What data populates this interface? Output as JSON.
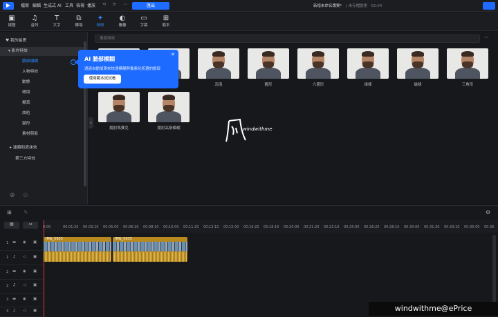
{
  "menu": [
    "檔案",
    "編輯",
    "生成式 AI",
    "工具",
    "檢視",
    "播放"
  ],
  "export_label": "匯出",
  "project_title": "新增未命名專案*",
  "project_meta": "| 未存檔變更 · 02:04",
  "toolbar": [
    {
      "icon": "media-icon",
      "label": "媒體"
    },
    {
      "icon": "audio-icon",
      "label": "音訊"
    },
    {
      "icon": "text-icon",
      "label": "文字"
    },
    {
      "icon": "transition-icon",
      "label": "轉場"
    },
    {
      "icon": "effect-icon",
      "label": "特效"
    },
    {
      "icon": "overlay-icon",
      "label": "覆疊"
    },
    {
      "icon": "subtitle-icon",
      "label": "字幕"
    },
    {
      "icon": "template-icon",
      "label": "範本"
    }
  ],
  "sidebar": {
    "favorites": "我的最愛",
    "video_effects": "影片特效",
    "items": [
      "臉部模糊",
      "人物特效",
      "動態",
      "環境",
      "擬真",
      "炫粒",
      "變形",
      "素材剪影"
    ],
    "lighting": "濾鏡和遮抹效",
    "third_party": "第三方特效"
  },
  "search_placeholder": "搜尋特效",
  "effects": [
    "",
    "",
    "泡泡",
    "圓形",
    "六邊形",
    "綠條",
    "磁條",
    "三角形",
    "鏡射馬賽克",
    "鏡射高斯模糊"
  ],
  "tooltip": {
    "title": "AI 臉部模糊",
    "body": "透過自動偵測來快速模糊與像素化所選的臉部",
    "button": "使用範本試試看"
  },
  "watermark": "windwithme",
  "timeline": {
    "ticks": [
      "0:00",
      "00:01:20",
      "00:03:10",
      "00:05:00",
      "00:06:20",
      "00:08:10",
      "00:10:00",
      "00:11:20",
      "00:13:10",
      "00:15:00",
      "00:16:20",
      "00:18:10",
      "00:20:00",
      "00:21:20",
      "00:23:10",
      "00:25:00",
      "00:26:20",
      "00:28:10",
      "00:30:00",
      "00:31:20",
      "00:33:10",
      "00:35:00",
      "00:36"
    ],
    "clip1": "IMG_5935",
    "clip2": "IMG_5935",
    "tracks": [
      "1",
      "1",
      "2",
      "2",
      "3",
      "3"
    ]
  },
  "credit": "windwithme@ePrice",
  "colors": {
    "accent": "#1d6bff",
    "clip": "#b88a1e"
  }
}
